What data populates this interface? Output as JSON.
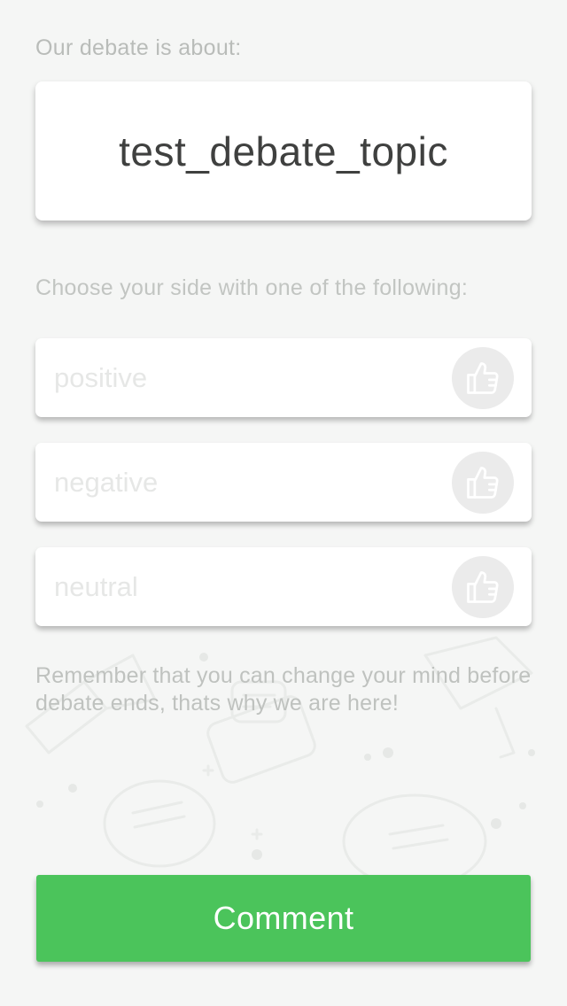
{
  "intro_label": "Our debate is about:",
  "topic": "test_debate_topic",
  "choose_label": "Choose your side with one of the following:",
  "options": [
    {
      "label": "positive",
      "icon": "thumbs-up-icon"
    },
    {
      "label": "negative",
      "icon": "thumbs-up-icon"
    },
    {
      "label": "neutral",
      "icon": "thumbs-up-icon"
    }
  ],
  "reminder": "Remember that you can change your mind before debate ends, thats why we are here!",
  "comment_button": "Comment",
  "colors": {
    "background": "#f5f6f5",
    "accent_green": "#4bc45b",
    "card": "#ffffff",
    "muted_text": "#bfc2bf",
    "icon_circle": "#ebebeb"
  }
}
